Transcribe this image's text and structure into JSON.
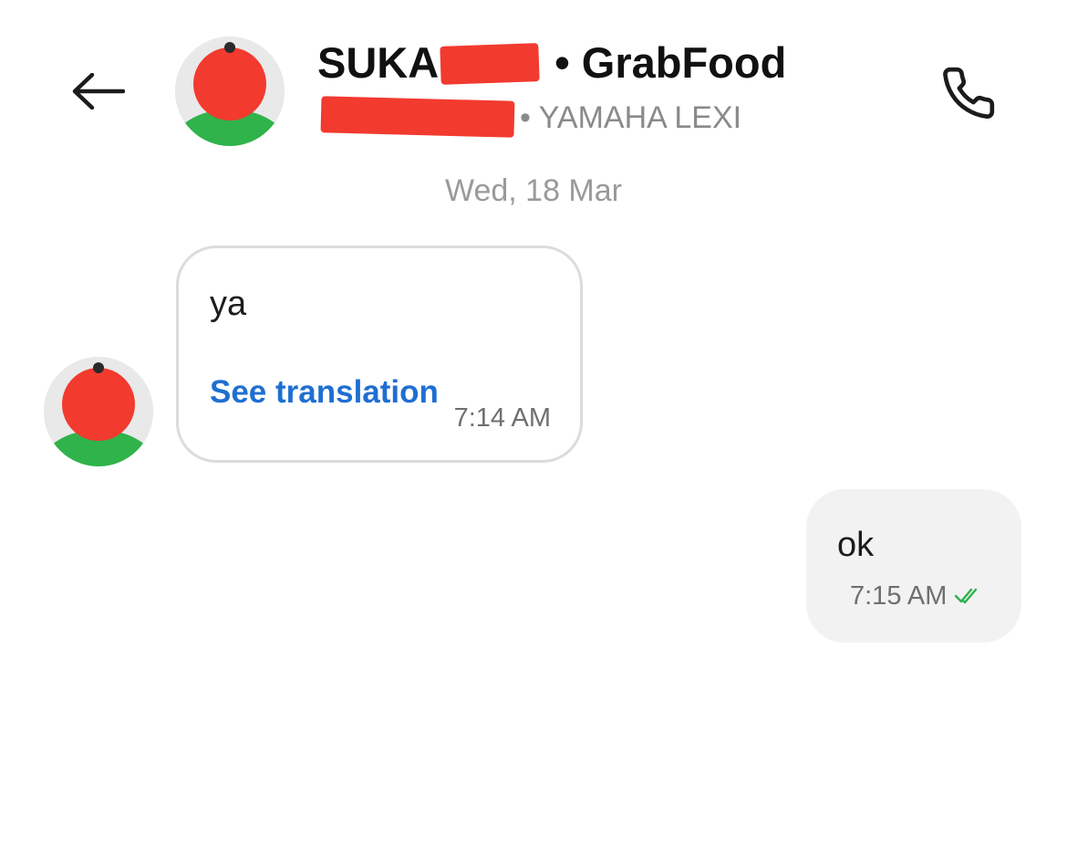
{
  "header": {
    "back_icon": "arrow-left-icon",
    "driver_name_prefix": "SUKA",
    "driver_name_suffix": " • GrabFood",
    "vehicle_suffix": "• YAMAHA LEXI",
    "call_icon": "phone-icon"
  },
  "date_separator": "Wed, 18 Mar",
  "messages": [
    {
      "direction": "incoming",
      "text": "ya",
      "translate_label": "See translation",
      "time": "7:14 AM"
    },
    {
      "direction": "outgoing",
      "text": "ok",
      "time": "7:15 AM",
      "status_icon": "double-check-icon"
    }
  ],
  "colors": {
    "link": "#1f6fd1",
    "read_check": "#2bb24c",
    "redaction": "#f23a2f",
    "avatar_shirt": "#2fb34a"
  }
}
